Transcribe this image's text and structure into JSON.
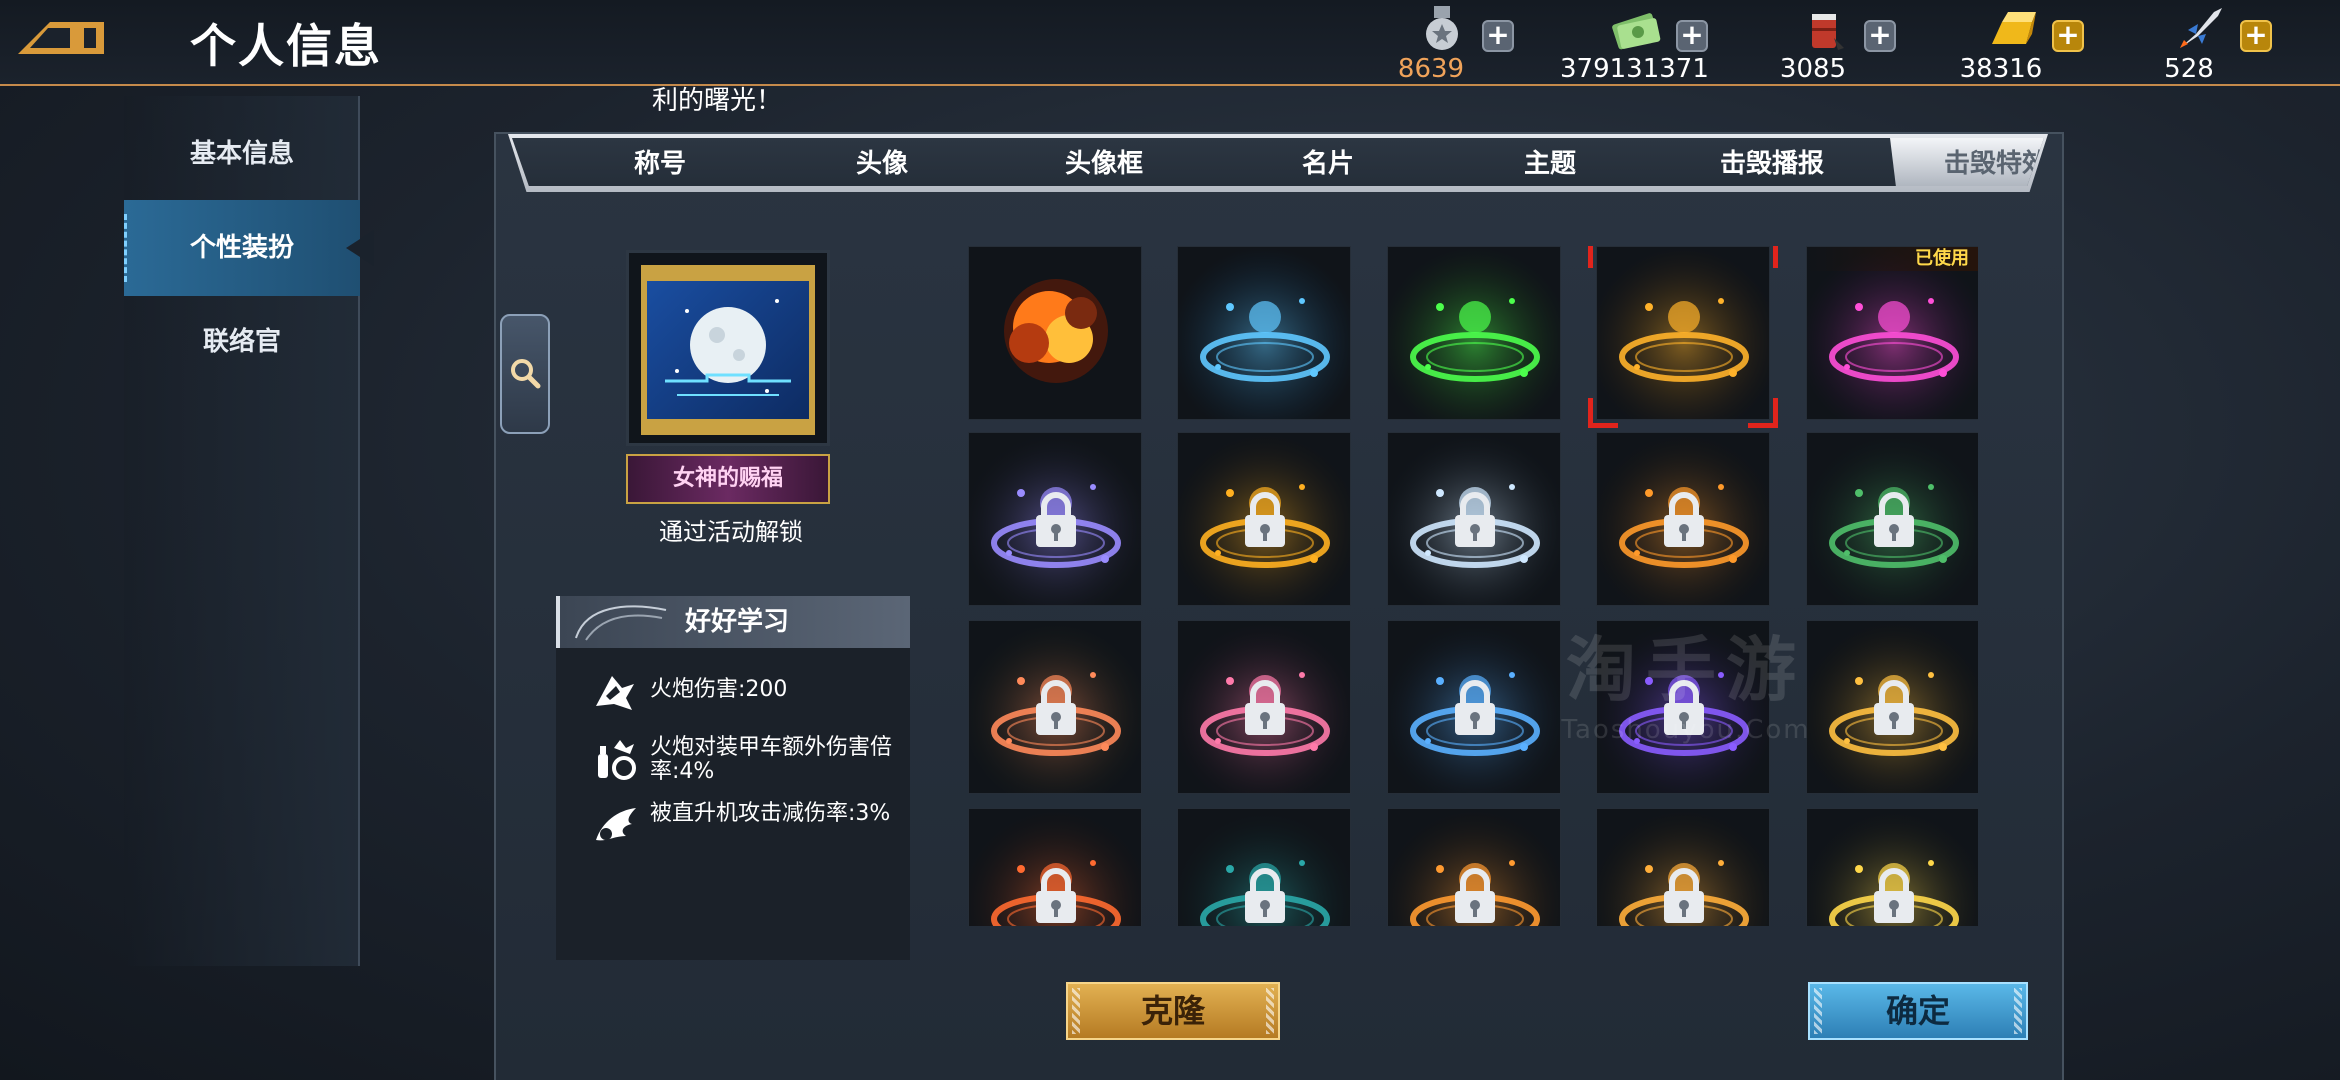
{
  "header": {
    "title": "个人信息",
    "resources": [
      {
        "icon": "medal-icon",
        "value": "8639",
        "highlight": true
      },
      {
        "icon": "cash-icon",
        "value": "379131371",
        "highlight": false
      },
      {
        "icon": "oil-barrel-icon",
        "value": "3085",
        "highlight": false
      },
      {
        "icon": "gold-bar-icon",
        "value": "38316",
        "highlight": false
      },
      {
        "icon": "rocket-icon",
        "value": "528",
        "highlight": false
      }
    ]
  },
  "marquee": "利的曙光！",
  "sidebar": {
    "items": [
      {
        "label": "基本信息",
        "active": false
      },
      {
        "label": "个性装扮",
        "active": true
      },
      {
        "label": "联络官",
        "active": false
      }
    ]
  },
  "tabs": [
    {
      "label": "称号",
      "active": false
    },
    {
      "label": "头像",
      "active": false
    },
    {
      "label": "头像框",
      "active": false
    },
    {
      "label": "名片",
      "active": false
    },
    {
      "label": "主题",
      "active": false
    },
    {
      "label": "击毁播报",
      "active": false
    },
    {
      "label": "击毁特效",
      "active": true
    }
  ],
  "preview": {
    "banner": "女神的赐福",
    "unlock_text": "通过活动解锁"
  },
  "stats": {
    "title": "好好学习",
    "rows": [
      {
        "icon": "cannon-icon",
        "text": "火炮伤害:200"
      },
      {
        "icon": "armor-shell-icon",
        "text": "火炮对装甲车额外伤害倍率:4%"
      },
      {
        "icon": "wing-shield-icon",
        "text": "被直升机攻击减伤率:3%"
      }
    ]
  },
  "effects": {
    "used_label": "已使用",
    "items": [
      {
        "name": "explosion",
        "locked": false,
        "colors": [
          "#ff7a1a",
          "#5a1a08"
        ]
      },
      {
        "name": "ice-ring",
        "locked": false,
        "colors": [
          "#5fc8ff",
          "#0b3b66"
        ]
      },
      {
        "name": "green-ring",
        "locked": false,
        "colors": [
          "#4cff4c",
          "#1a4a10"
        ]
      },
      {
        "name": "gold-ring",
        "locked": false,
        "selected": true,
        "colors": [
          "#ffb22a",
          "#4a2a05"
        ]
      },
      {
        "name": "pink-heart-ring",
        "locked": false,
        "used": true,
        "colors": [
          "#ff4fd8",
          "#3a0c4a"
        ]
      },
      {
        "name": "crystal-ring",
        "locked": true,
        "colors": [
          "#9a8cff",
          "#1c1b2c"
        ]
      },
      {
        "name": "pumpkin-gold-ring",
        "locked": true,
        "colors": [
          "#ffb020",
          "#2c1e08"
        ]
      },
      {
        "name": "snow-ring",
        "locked": true,
        "colors": [
          "#cfe8ff",
          "#1a2430"
        ]
      },
      {
        "name": "number-ring",
        "locked": true,
        "colors": [
          "#ff9a2a",
          "#2a1a0c"
        ]
      },
      {
        "name": "shield-vine-ring",
        "locked": true,
        "colors": [
          "#4fbf6a",
          "#10201a"
        ]
      },
      {
        "name": "flower-ring",
        "locked": true,
        "colors": [
          "#ff8a5a",
          "#1c2410"
        ]
      },
      {
        "name": "heart-petal-ring",
        "locked": true,
        "colors": [
          "#ff7aaa",
          "#241020"
        ]
      },
      {
        "name": "blue-flower-ring",
        "locked": true,
        "colors": [
          "#5ab0ff",
          "#0e1a2c"
        ]
      },
      {
        "name": "purple-ring",
        "locked": true,
        "colors": [
          "#8a5cff",
          "#1a1030"
        ]
      },
      {
        "name": "golden-wing-ring",
        "locked": true,
        "colors": [
          "#ffc040",
          "#2a1e08"
        ]
      },
      {
        "name": "red-gold-ring",
        "locked": true,
        "colors": [
          "#ff6a30",
          "#2a1008"
        ]
      },
      {
        "name": "pumpkin-tree-ring",
        "locked": true,
        "colors": [
          "#2aa8a8",
          "#0a1a1a"
        ]
      },
      {
        "name": "sword-ring",
        "locked": true,
        "colors": [
          "#ff9a30",
          "#2a1808"
        ]
      },
      {
        "name": "crown-ring",
        "locked": true,
        "colors": [
          "#ffae3a",
          "#2a1c08"
        ]
      },
      {
        "name": "star-tree-ring",
        "locked": true,
        "colors": [
          "#ffd84a",
          "#1a1a0c"
        ]
      }
    ]
  },
  "watermark": {
    "line1": "淘手游",
    "line2": "Taoshouyou.Com"
  },
  "buttons": {
    "clone": "克隆",
    "confirm": "确定"
  }
}
